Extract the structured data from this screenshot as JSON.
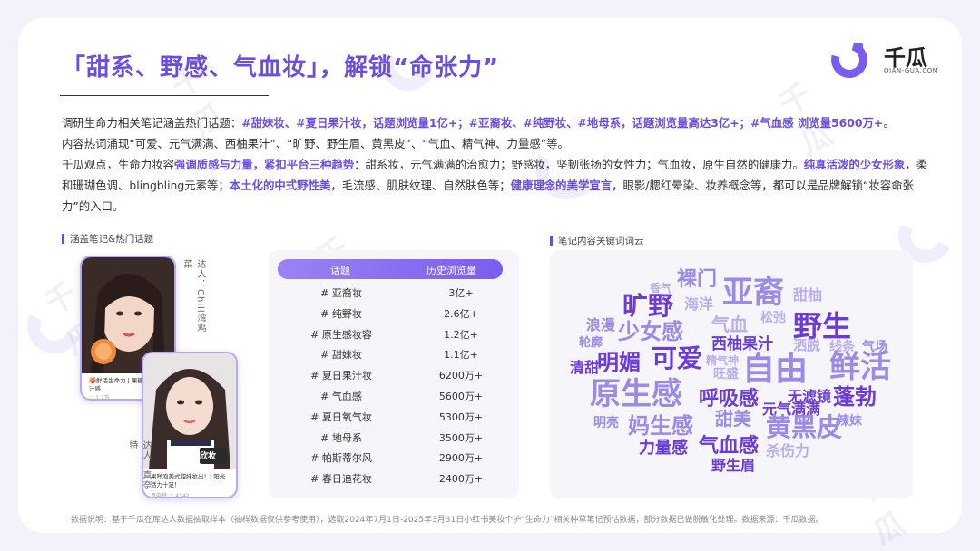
{
  "title": "「甜系、野感、气血妆」，解锁“命张力”",
  "logo": {
    "name": "千瓜",
    "sub": "QIAN-GUA.COM"
  },
  "paragraph1": {
    "p1": "调研生命力相关笔记涵盖热门话题：",
    "h1": "#甜妹妆、#夏日果汁妆，话题浏览量1亿+；#亚裔妆、#纯野妆、#地母系，话题浏览量高达3亿+；#气血感 浏览量5600万+",
    "p2": "。",
    "line2": "内容热词涌现“可爱、元气满满、西柚果汁”、“旷野、野生眉、黄黑皮”、“气血、精气神、力量感”等。"
  },
  "paragraph2": {
    "p1": "千瓜观点，生命力妆容",
    "h1": "强调质感与力量，紧扣平台三种趋势",
    "p2": "：甜系妆，元气满满的治愈力；野感妆，坚韧张扬的女性力；气血妆，原生自然的健康力。",
    "h2": "纯真活泼的少女形象",
    "p3": "，柔和珊瑚色调、blingbling元素等；",
    "h3": "本土化的中式野性美",
    "p4": "，毛流感、肌肤纹理、自然肤色等；",
    "h4": "健康理念的美学宣言",
    "p5": "，眼影/腮红晕染、妆养概念等，都可以是品牌解锁“妆容命张力”的入口。"
  },
  "left_section_label": "涵盖笔记&热门话题",
  "right_section_label": "笔记内容关键词词云",
  "cards": [
    {
      "author": "达人：Chill湾鸡菜",
      "caption": "🍑鲜活生命力 | 果糖这份的果汁感",
      "meta": "♡ 1.2万"
    },
    {
      "author": "达人：真奈特",
      "caption": "果咩泡美式甜妹妆出！| 阳光活力十足！",
      "meta": "真奈特   ♡ 4142",
      "badge": "欣妆"
    }
  ],
  "table": {
    "headers": [
      "话题",
      "历史浏览量"
    ],
    "rows": [
      [
        "# 亚裔妆",
        "3亿+"
      ],
      [
        "# 纯野妆",
        "2.6亿+"
      ],
      [
        "# 原生感妆容",
        "1.2亿+"
      ],
      [
        "# 甜妹妆",
        "1.1亿+"
      ],
      [
        "# 夏日果汁妆",
        "6200万+"
      ],
      [
        "# 气血感",
        "5600万+"
      ],
      [
        "# 夏日氧气妆",
        "5300万+"
      ],
      [
        "# 地母系",
        "3500万+"
      ],
      [
        "# 帕斯蒂尔风",
        "2900万+"
      ],
      [
        "# 春日追花妆",
        "2400万+"
      ]
    ]
  },
  "wordcloud": [
    {
      "text": "亚裔",
      "color": "#9b8ae8",
      "size": 34
    },
    {
      "text": "野生",
      "color": "#6a3bd6",
      "size": 32
    },
    {
      "text": "旷野",
      "color": "#6a3bd6",
      "size": 28
    },
    {
      "text": "裸门",
      "color": "#9b8ae8",
      "size": 22
    },
    {
      "text": "香气",
      "color": "#b8aef0",
      "size": 12
    },
    {
      "text": "海洋",
      "color": "#b8aef0",
      "size": 16
    },
    {
      "text": "甜柚",
      "color": "#b8aef0",
      "size": 16
    },
    {
      "text": "浪漫",
      "color": "#9b8ae8",
      "size": 16
    },
    {
      "text": "少女感",
      "color": "#9b8ae8",
      "size": 24
    },
    {
      "text": "气血",
      "color": "#b8aef0",
      "size": 20
    },
    {
      "text": "松弛",
      "color": "#b8aef0",
      "size": 14
    },
    {
      "text": "轮廓",
      "color": "#9b8ae8",
      "size": 13
    },
    {
      "text": "西柚果汁",
      "color": "#6a3bd6",
      "size": 17
    },
    {
      "text": "洒脱",
      "color": "#b8aef0",
      "size": 15
    },
    {
      "text": "线条",
      "color": "#b8aef0",
      "size": 14
    },
    {
      "text": "气场",
      "color": "#9b8ae8",
      "size": 14
    },
    {
      "text": "精气神",
      "color": "#b8aef0",
      "size": 12
    },
    {
      "text": "可爱",
      "color": "#6a3bd6",
      "size": 28
    },
    {
      "text": "清甜",
      "color": "#6a3bd6",
      "size": 16
    },
    {
      "text": "明媚",
      "color": "#6a3bd6",
      "size": 24
    },
    {
      "text": "旺盛",
      "color": "#b8aef0",
      "size": 14
    },
    {
      "text": "自由",
      "color": "#9b8ae8",
      "size": 36
    },
    {
      "text": "鲜活",
      "color": "#9b8ae8",
      "size": 34
    },
    {
      "text": "原生感",
      "color": "#9b8ae8",
      "size": 34
    },
    {
      "text": "呼吸感",
      "color": "#6a3bd6",
      "size": 22
    },
    {
      "text": "无滤镜",
      "color": "#6a3bd6",
      "size": 16
    },
    {
      "text": "蓬勃",
      "color": "#6a3bd6",
      "size": 24
    },
    {
      "text": "元气满满",
      "color": "#6a3bd6",
      "size": 16
    },
    {
      "text": "明亮",
      "color": "#9b8ae8",
      "size": 14
    },
    {
      "text": "甜美",
      "color": "#9b8ae8",
      "size": 20
    },
    {
      "text": "辣妹",
      "color": "#9b8ae8",
      "size": 14
    },
    {
      "text": "妈生感",
      "color": "#9b8ae8",
      "size": 24
    },
    {
      "text": "黄黑皮",
      "color": "#9b8ae8",
      "size": 28
    },
    {
      "text": "力量感",
      "color": "#6a3bd6",
      "size": 18
    },
    {
      "text": "气血感",
      "color": "#6a3bd6",
      "size": 22
    },
    {
      "text": "杀伤力",
      "color": "#b8aef0",
      "size": 16
    },
    {
      "text": "野生眉",
      "color": "#6a3bd6",
      "size": 16
    }
  ],
  "footnote": "数据说明：基于千瓜在库达人数据抽取样本（抽样数据仅供参考使用），选取2024年7月1日-2025年3月31日小红书美妆个护“生命力”相关种草笔记预估数据，部分数据已做脱敏化处理。数据来源：千瓜数据。",
  "watermark": {
    "text": "千瓜",
    "sub": "QIAN-GUA.COM"
  }
}
